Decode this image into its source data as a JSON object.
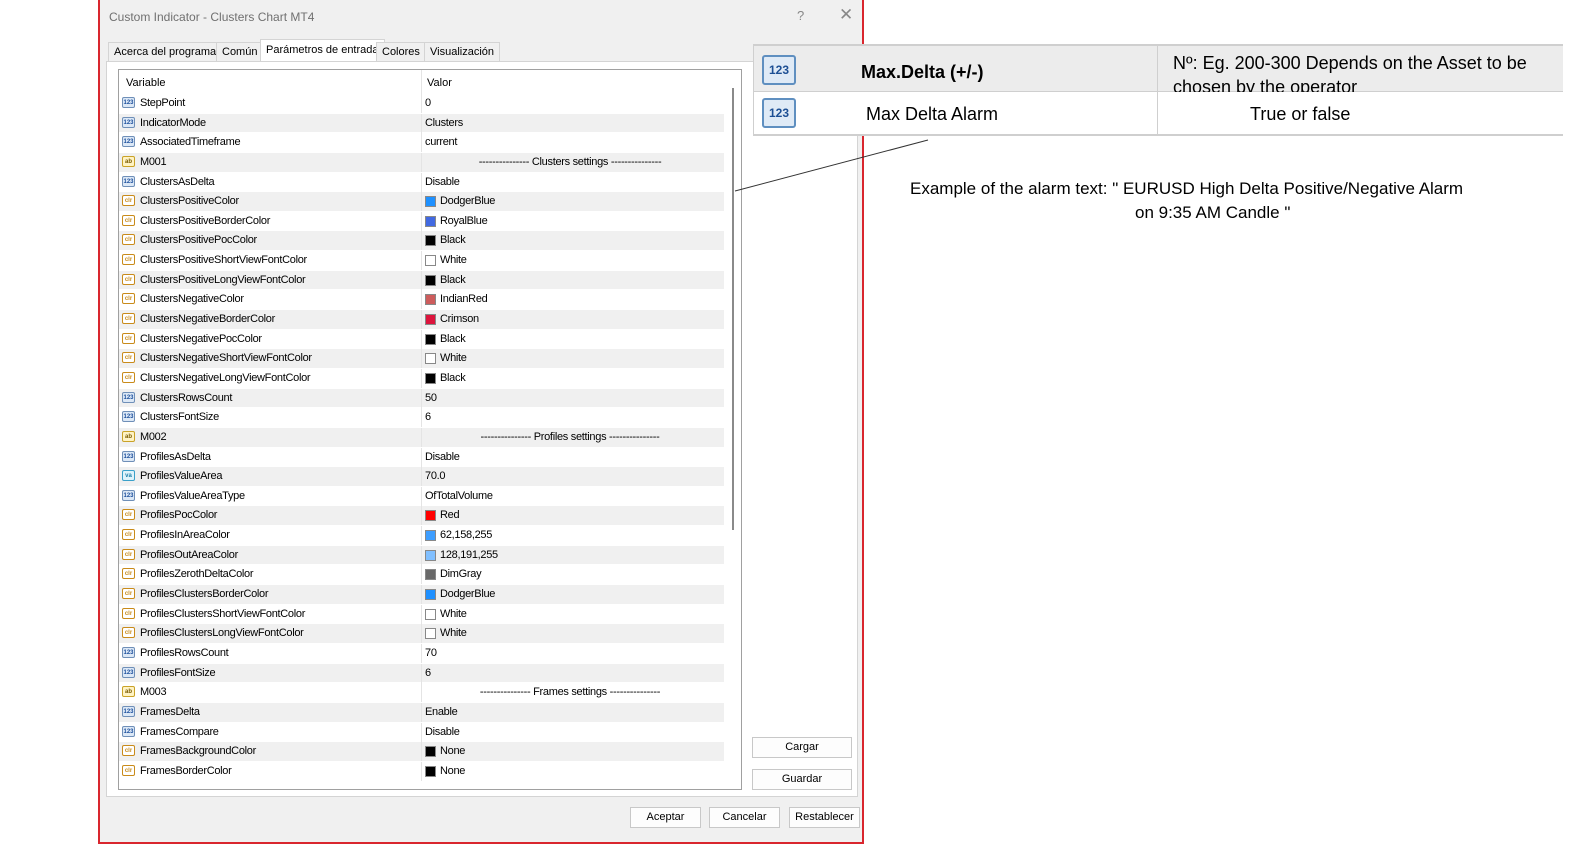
{
  "window": {
    "title": "Custom Indicator - Clusters Chart MT4",
    "help": "?",
    "close": "✕"
  },
  "tabs": [
    "Acerca del programa",
    "Común",
    "Parámetros de entrada",
    "Colores",
    "Visualización"
  ],
  "grid": {
    "col_variable": "Variable",
    "col_value": "Valor",
    "rows": [
      {
        "icon": "123",
        "name": "StepPoint",
        "value": "0"
      },
      {
        "icon": "123",
        "name": "IndicatorMode",
        "value": "Clusters"
      },
      {
        "icon": "123",
        "name": "AssociatedTimeframe",
        "value": "current"
      },
      {
        "icon": "ab",
        "name": "M001",
        "value": "--------------- Clusters settings ---------------",
        "center": true
      },
      {
        "icon": "123",
        "name": "ClustersAsDelta",
        "value": "Disable"
      },
      {
        "icon": "clr",
        "name": "ClustersPositiveColor",
        "value": "DodgerBlue",
        "swatch": "#1e90ff"
      },
      {
        "icon": "clr",
        "name": "ClustersPositiveBorderColor",
        "value": "RoyalBlue",
        "swatch": "#4169e1"
      },
      {
        "icon": "clr",
        "name": "ClustersPositivePocColor",
        "value": "Black",
        "swatch": "#000000"
      },
      {
        "icon": "clr",
        "name": "ClustersPositiveShortViewFontColor",
        "value": "White",
        "swatch": "#ffffff"
      },
      {
        "icon": "clr",
        "name": "ClustersPositiveLongViewFontColor",
        "value": "Black",
        "swatch": "#000000"
      },
      {
        "icon": "clr",
        "name": "ClustersNegativeColor",
        "value": "IndianRed",
        "swatch": "#cd5c5c"
      },
      {
        "icon": "clr",
        "name": "ClustersNegativeBorderColor",
        "value": "Crimson",
        "swatch": "#dc143c"
      },
      {
        "icon": "clr",
        "name": "ClustersNegativePocColor",
        "value": "Black",
        "swatch": "#000000"
      },
      {
        "icon": "clr",
        "name": "ClustersNegativeShortViewFontColor",
        "value": "White",
        "swatch": "#ffffff"
      },
      {
        "icon": "clr",
        "name": "ClustersNegativeLongViewFontColor",
        "value": "Black",
        "swatch": "#000000"
      },
      {
        "icon": "123",
        "name": "ClustersRowsCount",
        "value": "50"
      },
      {
        "icon": "123",
        "name": "ClustersFontSize",
        "value": "6"
      },
      {
        "icon": "ab",
        "name": "M002",
        "value": "--------------- Profiles settings ---------------",
        "center": true
      },
      {
        "icon": "123",
        "name": "ProfilesAsDelta",
        "value": "Disable"
      },
      {
        "icon": "va",
        "name": "ProfilesValueArea",
        "value": "70.0"
      },
      {
        "icon": "123",
        "name": "ProfilesValueAreaType",
        "value": "OfTotalVolume"
      },
      {
        "icon": "clr",
        "name": "ProfilesPocColor",
        "value": "Red",
        "swatch": "#ff0000"
      },
      {
        "icon": "clr",
        "name": "ProfilesInAreaColor",
        "value": "62,158,255",
        "swatch": "#3e9eff"
      },
      {
        "icon": "clr",
        "name": "ProfilesOutAreaColor",
        "value": "128,191,255",
        "swatch": "#80bfff"
      },
      {
        "icon": "clr",
        "name": "ProfilesZerothDeltaColor",
        "value": "DimGray",
        "swatch": "#696969"
      },
      {
        "icon": "clr",
        "name": "ProfilesClustersBorderColor",
        "value": "DodgerBlue",
        "swatch": "#1e90ff"
      },
      {
        "icon": "clr",
        "name": "ProfilesClustersShortViewFontColor",
        "value": "White",
        "swatch": "#ffffff"
      },
      {
        "icon": "clr",
        "name": "ProfilesClustersLongViewFontColor",
        "value": "White",
        "swatch": "#ffffff"
      },
      {
        "icon": "123",
        "name": "ProfilesRowsCount",
        "value": "70"
      },
      {
        "icon": "123",
        "name": "ProfilesFontSize",
        "value": "6"
      },
      {
        "icon": "ab",
        "name": "M003",
        "value": "--------------- Frames settings ---------------",
        "center": true
      },
      {
        "icon": "123",
        "name": "FramesDelta",
        "value": "Enable"
      },
      {
        "icon": "123",
        "name": "FramesCompare",
        "value": "Disable"
      },
      {
        "icon": "clr",
        "name": "FramesBackgroundColor",
        "value": "None",
        "swatch": "#000000"
      },
      {
        "icon": "clr",
        "name": "FramesBorderColor",
        "value": "None",
        "swatch": "#000000"
      }
    ]
  },
  "side_buttons": {
    "load": "Cargar",
    "save": "Guardar"
  },
  "bottom_buttons": {
    "accept": "Aceptar",
    "cancel": "Cancelar",
    "reset": "Restablecer"
  },
  "annotation": {
    "rows": [
      {
        "icon": "123",
        "name": "Max.Delta (+/-)",
        "desc": "Nº: Eg. 200-300 Depends on the Asset to be chosen by the operator"
      },
      {
        "icon": "123",
        "name": "Max Delta Alarm",
        "desc": "True or false"
      }
    ],
    "example_line1": "Example of the alarm text: \" EURUSD High Delta Positive/Negative Alarm",
    "example_line2": "on 9:35 AM Candle \""
  }
}
